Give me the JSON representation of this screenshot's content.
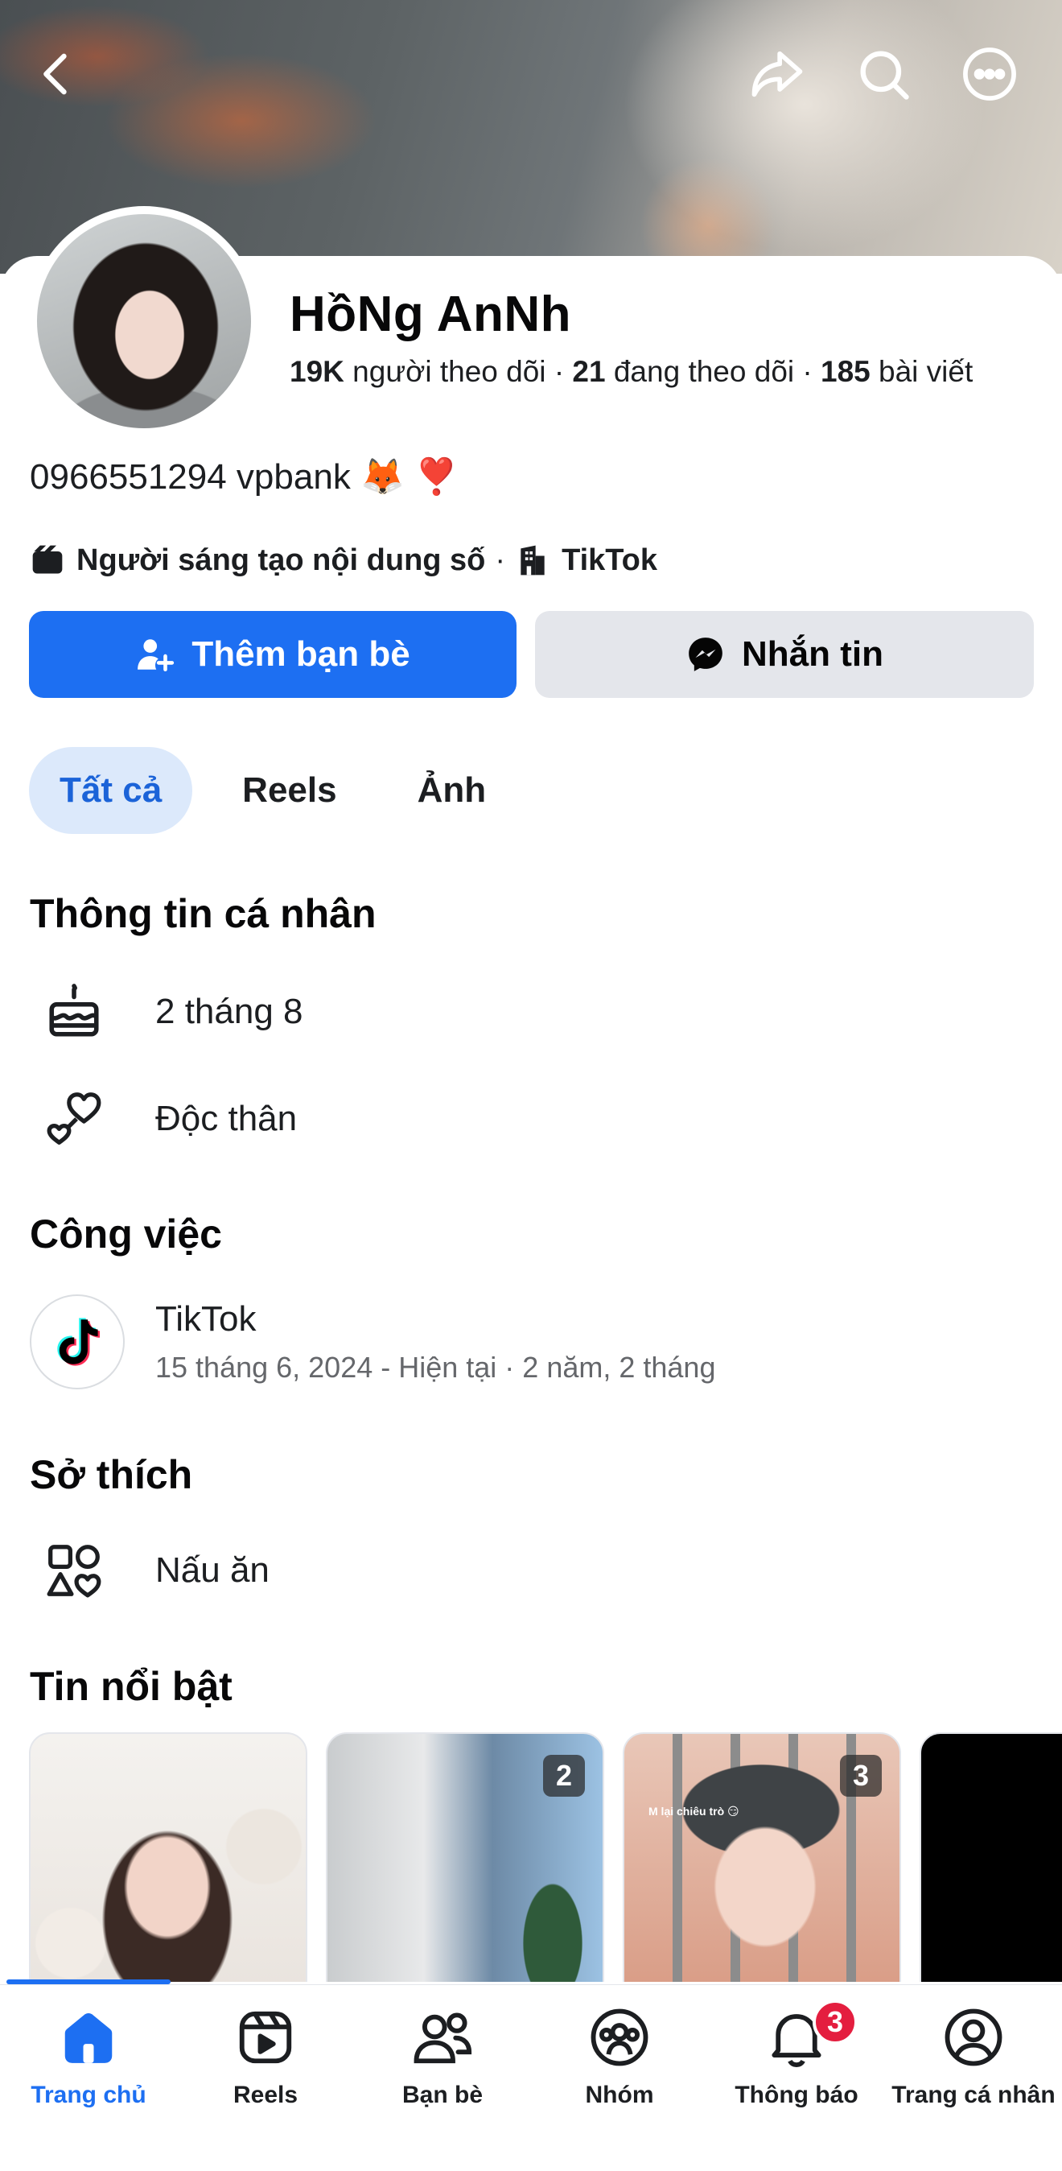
{
  "profile": {
    "name": "HồNg AnNh",
    "followers_count": "19K",
    "followers_label": "người theo dõi",
    "following_count": "21",
    "following_label": "đang theo dõi",
    "posts_count": "185",
    "posts_label": "bài viết",
    "bio": "0966551294 vpbank 🦊 ❣️",
    "category": "Người sáng tạo nội dung số",
    "workplace": "TikTok"
  },
  "actions": {
    "add_friend_label": "Thêm bạn bè",
    "message_label": "Nhắn tin"
  },
  "tabs": [
    {
      "label": "Tất cả",
      "active": true
    },
    {
      "label": "Reels",
      "active": false
    },
    {
      "label": "Ảnh",
      "active": false
    }
  ],
  "personal_info": {
    "title": "Thông tin cá nhân",
    "birthday": "2 tháng 8",
    "relationship": "Độc thân"
  },
  "work": {
    "title": "Công việc",
    "company": "TikTok",
    "period": "15 tháng 6, 2024 - Hiện tại · 2 năm, 2 tháng"
  },
  "hobbies": {
    "title": "Sở thích",
    "item": "Nấu ăn"
  },
  "highlights": {
    "title": "Tin nổi bật",
    "items": [
      {
        "count": ""
      },
      {
        "count": "2"
      },
      {
        "count": "3",
        "caption": "M lại chiêu trò 😏"
      },
      {
        "count": ""
      }
    ]
  },
  "bottom_nav": [
    {
      "label": "Trang chủ",
      "icon": "home-icon",
      "active": true
    },
    {
      "label": "Reels",
      "icon": "reels-icon"
    },
    {
      "label": "Bạn bè",
      "icon": "friends-icon"
    },
    {
      "label": "Nhóm",
      "icon": "groups-icon"
    },
    {
      "label": "Thông báo",
      "icon": "bell-icon",
      "badge": "3"
    },
    {
      "label": "Trang cá nhân",
      "icon": "profile-icon"
    }
  ],
  "colors": {
    "accent": "#1d6ff2",
    "chip_active_bg": "#dce9fb",
    "badge": "#e41e3f",
    "secondary_button": "#e4e6eb"
  }
}
